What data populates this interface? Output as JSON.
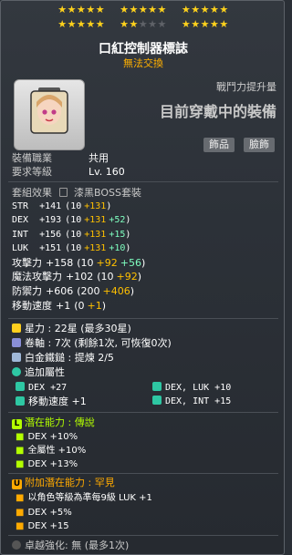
{
  "stars": {
    "row1": "★★★★★",
    "row2": "★★★★★",
    "row3": "★★★★★",
    "row4": "★★★★★",
    "row5_on": "★★",
    "row5_off": "★★★",
    "row6": "★★★★★"
  },
  "item": {
    "name": "口紅控制器標誌",
    "trade": "無法交換"
  },
  "header": {
    "power_label": "戰鬥力提升量",
    "equipped": "目前穿戴中的裝備"
  },
  "tags": [
    "飾品",
    "臉飾"
  ],
  "req": {
    "job_label": "裝備職業",
    "job_value": "共用",
    "level_label": "要求等級",
    "level_value": "Lv. 160"
  },
  "set": {
    "label": "套組效果",
    "name": "漆黑BOSS套裝"
  },
  "stats": [
    {
      "name": "STR",
      "total": "+141",
      "base": "10",
      "add": "+131",
      "extra": ""
    },
    {
      "name": "DEX",
      "total": "+193",
      "base": "10",
      "add": "+131",
      "extra": "+52"
    },
    {
      "name": "INT",
      "total": "+156",
      "base": "10",
      "add": "+131",
      "extra": "+15"
    },
    {
      "name": "LUK",
      "total": "+151",
      "base": "10",
      "add": "+131",
      "extra": "+10"
    },
    {
      "name": "攻擊力",
      "total": "+158",
      "base": "10",
      "add": "+92",
      "extra": "+56"
    },
    {
      "name": "魔法攻擊力",
      "total": "+102",
      "base": "10",
      "add": "+92",
      "extra": ""
    },
    {
      "name": "防禦力",
      "total": "+606",
      "base": "200",
      "add": "+406",
      "extra": ""
    },
    {
      "name": "移動速度",
      "total": "+1",
      "base": "0",
      "add": "+1",
      "extra": ""
    }
  ],
  "enhance": {
    "star": "星力 : 22星 (最多30星)",
    "scroll": "卷軸 : 7次 (剩餘1次, 可恢復0次)",
    "hammer": "白金鐵鎚 : 提煉 2/5",
    "flame_label": "追加屬性",
    "flames": [
      "DEX +27",
      "DEX, LUK  +10",
      "移動速度 +1",
      "DEX, INT  +15"
    ]
  },
  "potential": {
    "label": "潛在能力 : 傳說",
    "lines": [
      "DEX +10%",
      "全屬性 +10%",
      "DEX +13%"
    ]
  },
  "additional": {
    "label": "附加潛在能力 : 罕見",
    "lines": [
      "以角色等級為準每9級 LUK +1",
      "DEX +5%",
      "DEX +15"
    ]
  },
  "footer": {
    "label": "卓越強化: 無 (最多1次)"
  },
  "colors": {
    "star_on": "#ffd21c",
    "potential_legend": "#b3ff00",
    "additional_rare": "#ffaa00",
    "flame_teal": "#2ec7a3"
  }
}
